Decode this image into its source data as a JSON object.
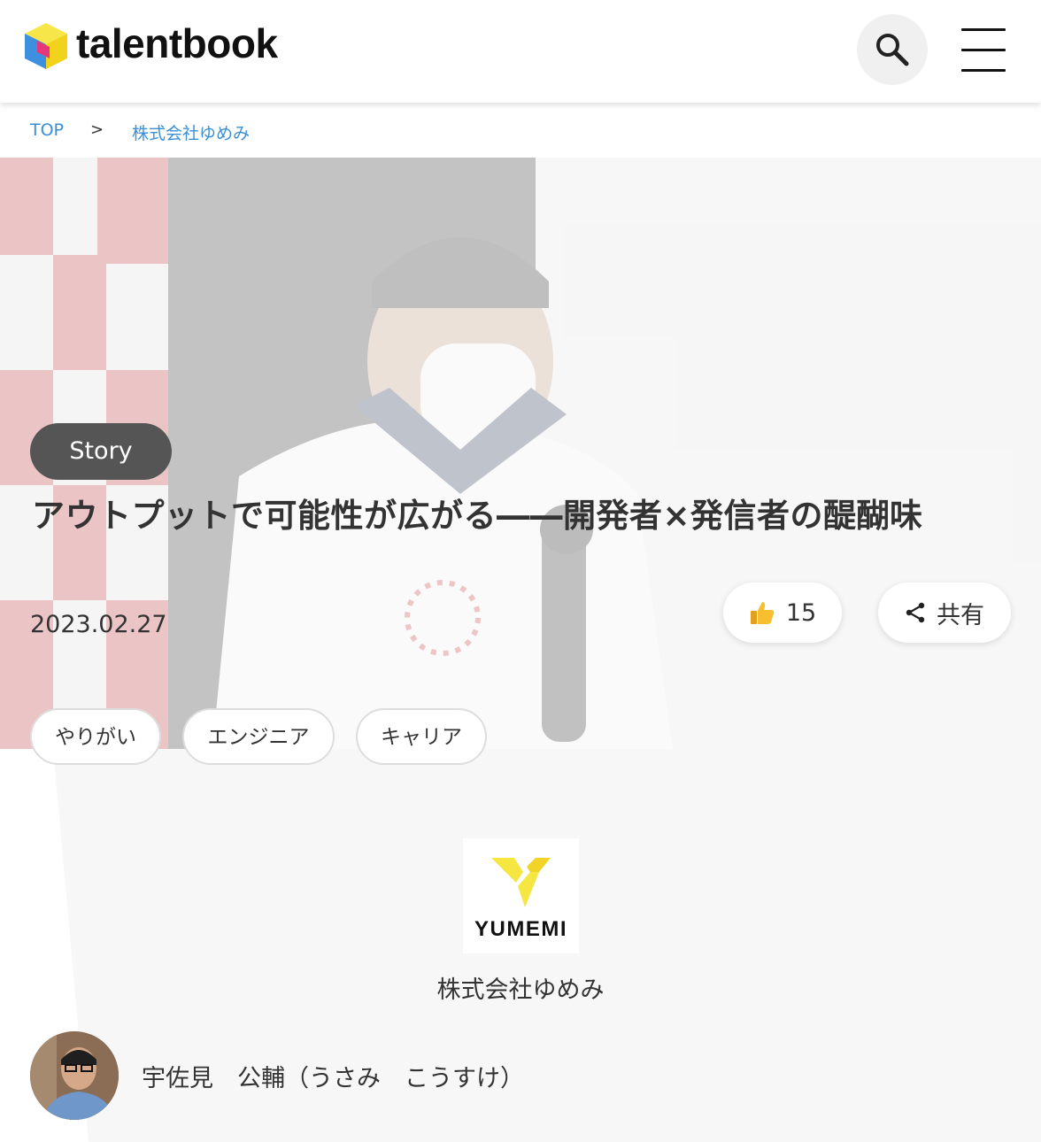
{
  "header": {
    "brand": "talentbook",
    "search_icon": "search-icon",
    "menu_icon": "hamburger-menu-icon"
  },
  "breadcrumb": {
    "items": [
      "TOP",
      "株式会社ゆめみ"
    ],
    "separator": ">"
  },
  "article": {
    "category": "Story",
    "title": "アウトプットで可能性が広がる――開発者×発信者の醍醐味",
    "date": "2023.02.27",
    "likes": "15",
    "share_label": "共有",
    "tags": [
      "やりがい",
      "エンジニア",
      "キャリア"
    ]
  },
  "company": {
    "logo_text": "YUMEMI",
    "name": "株式会社ゆめみ"
  },
  "author": {
    "name": "宇佐見　公輔（うさみ　こうすけ）"
  },
  "colors": {
    "link": "#3a8fd6",
    "badge": "#555555",
    "logo_yellow": "#f5e642"
  }
}
